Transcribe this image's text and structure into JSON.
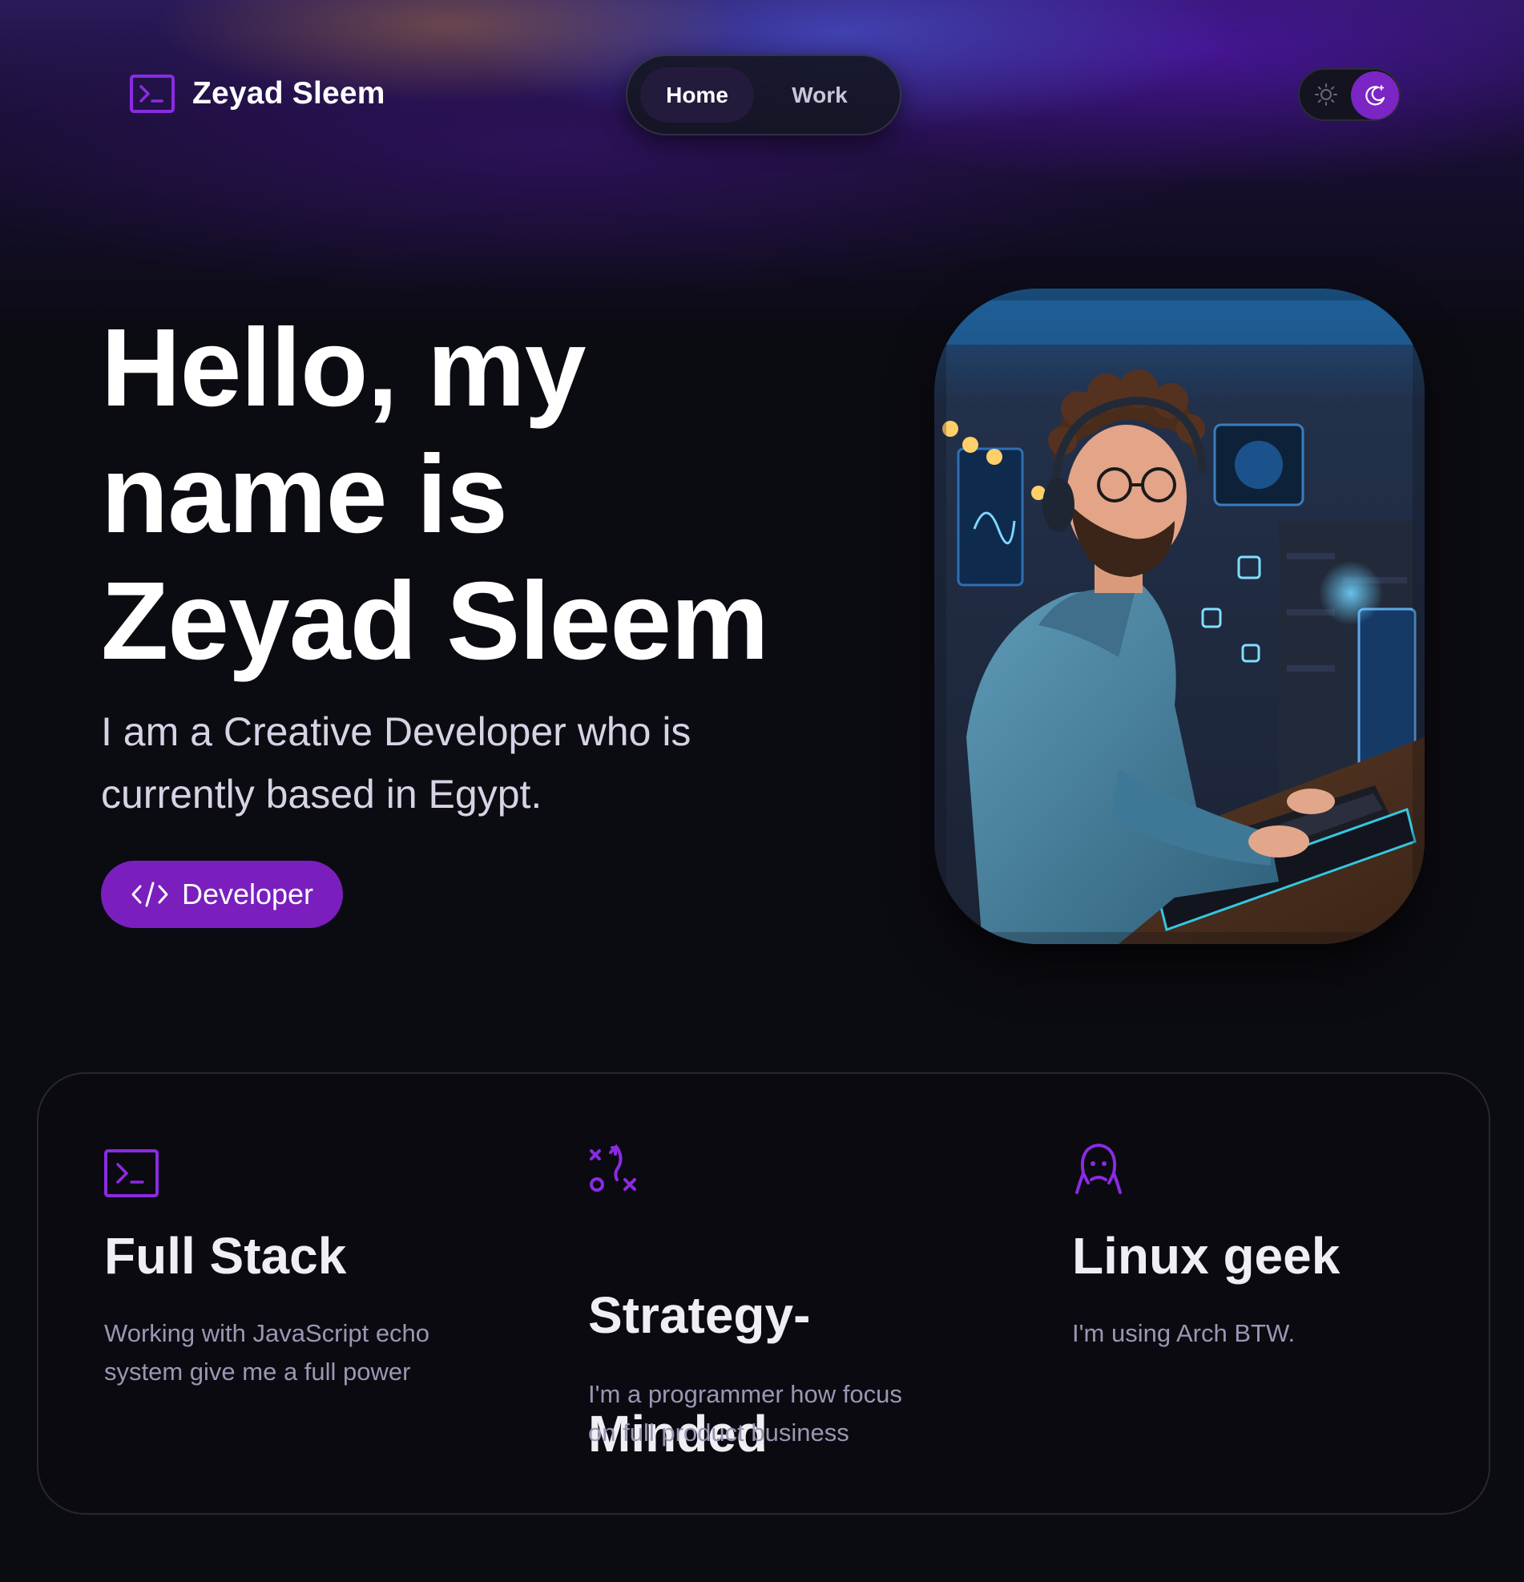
{
  "header": {
    "brand_name": "Zeyad Sleem",
    "nav": [
      {
        "label": "Home",
        "active": true
      },
      {
        "label": "Work",
        "active": false
      }
    ],
    "theme": {
      "options": [
        "light",
        "dark"
      ],
      "selected": "dark"
    }
  },
  "hero": {
    "title_lines": [
      "Hello, my",
      "name is",
      "Zeyad Sleem"
    ],
    "subtitle_lines": [
      "I am a Creative Developer who is",
      "currently based in Egypt."
    ],
    "role_button": {
      "icon": "code-icon",
      "label": "Developer"
    },
    "portrait": {
      "alt": "3D avatar of a developer with headphones typing at a keyboard"
    }
  },
  "features": [
    {
      "icon": "terminal-icon",
      "title": "Full Stack",
      "description_lines": [
        "Working with JavaScript echo",
        "system give me a full power"
      ]
    },
    {
      "icon": "strategy-icon",
      "title_lines": [
        "Strategy-",
        "Minded"
      ],
      "description_lines": [
        "I'm a programmer how focus",
        "on full product business"
      ]
    },
    {
      "icon": "ghost-icon",
      "title": "Linux geek",
      "description_lines": [
        "I'm using Arch BTW."
      ]
    }
  ],
  "colors": {
    "background": "#0b0b12",
    "accent": "#7a1fbd",
    "nav_active_bg": "#241a3c",
    "icon_purple": "#8a2be2",
    "muted_text": "#9a97b3"
  }
}
